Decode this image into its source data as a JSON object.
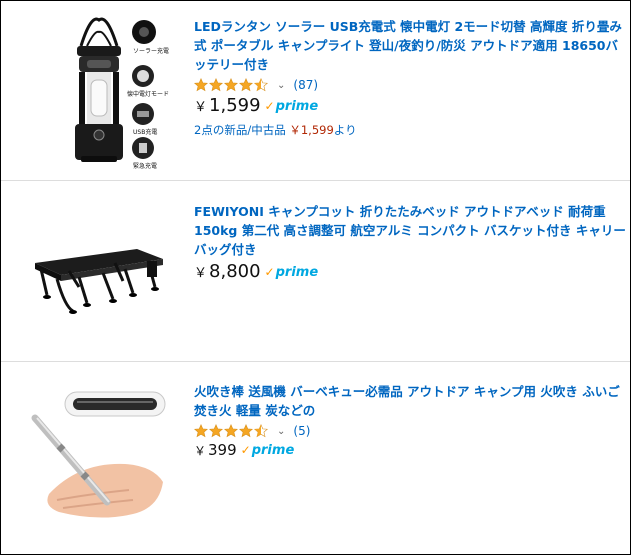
{
  "results": [
    {
      "title": "LEDランタン ソーラー USB充電式 懐中電灯 2モード切替 高輝度 折り畳み式 ポータブル キャンプライト 登山/夜釣り/防災 アウトドア適用 18650バッテリー付き",
      "rating": 4.5,
      "review_count": "(87)",
      "currency": "￥",
      "price": "1,599",
      "prime": "prime",
      "offers_prefix": "2点の新品/中古品",
      "offers_price": "￥1,599",
      "offers_suffix": "より",
      "image_labels": [
        "ソーラー充電",
        "懐中電灯モード",
        "USB充電",
        "緊急充電"
      ],
      "image_icon": "camping-lantern"
    },
    {
      "title": "FEWIYONI キャンプコット 折りたたみベッド アウトドアベッド 耐荷重150kg 第二代 高さ調整可 航空アルミ コンパクト バスケット付き キャリーバッグ付き",
      "currency": "￥",
      "price": "8,800",
      "prime": "prime",
      "image_icon": "camping-cot"
    },
    {
      "title": "火吹き棒 送風機 バーベキュー必需品 アウトドア キャンプ用 火吹き ふいご 焚き火 軽量 炭などの",
      "rating": 4.5,
      "review_count": "(5)",
      "currency": "￥",
      "price": "399",
      "prime": "prime",
      "image_icon": "fire-blowing-pipe"
    }
  ],
  "colors": {
    "link": "#0066c0",
    "star": "#f5a623",
    "prime_blue": "#00a8e1",
    "prime_check": "#ff9900",
    "offer_price": "#b12704"
  }
}
